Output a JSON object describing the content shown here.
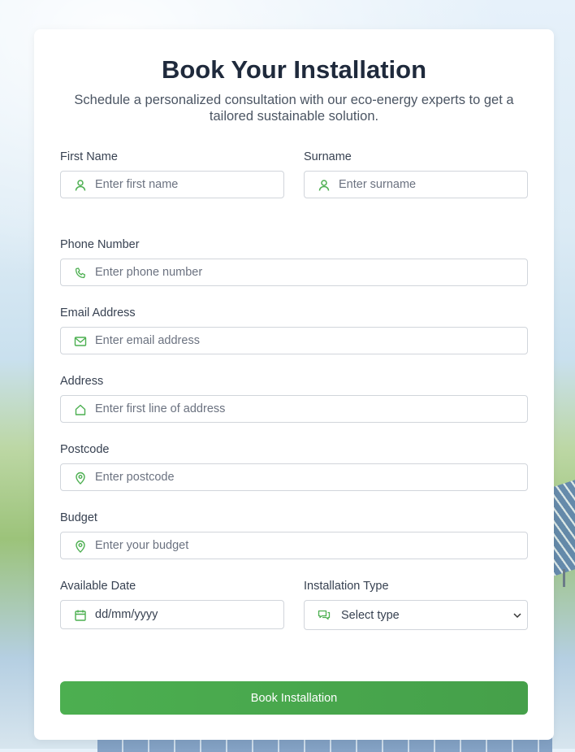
{
  "form": {
    "title": "Book Your Installation",
    "subtitle": "Schedule a personalized consultation with our eco-energy experts to get a tailored sustainable solution.",
    "first_name": {
      "label": "First Name",
      "placeholder": "Enter first name",
      "icon": "user-icon"
    },
    "surname": {
      "label": "Surname",
      "placeholder": "Enter surname",
      "icon": "user-icon"
    },
    "phone": {
      "label": "Phone Number",
      "placeholder": "Enter phone number",
      "icon": "phone-icon"
    },
    "email": {
      "label": "Email Address",
      "placeholder": "Enter email address",
      "icon": "mail-icon"
    },
    "address": {
      "label": "Address",
      "placeholder": "Enter first line of address",
      "icon": "home-icon"
    },
    "postcode": {
      "label": "Postcode",
      "placeholder": "Enter postcode",
      "icon": "map-pin-icon"
    },
    "budget": {
      "label": "Budget",
      "placeholder": "Enter your budget",
      "icon": "map-pin-icon"
    },
    "date": {
      "label": "Available Date",
      "value": "dd/mm/yyyy",
      "icon": "calendar-icon"
    },
    "installation_type": {
      "label": "Installation Type",
      "selected": "Select type",
      "icon": "chat-icon"
    },
    "submit_label": "Book Installation"
  },
  "colors": {
    "accent": "#4caf50",
    "title": "#1f2a3c",
    "border": "#d1d5db"
  }
}
